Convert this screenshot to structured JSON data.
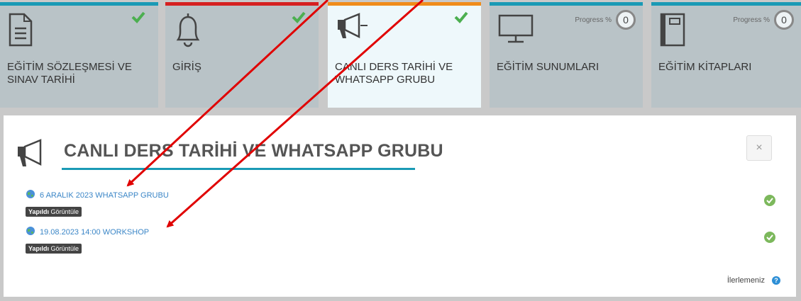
{
  "colors": {
    "tile_accent": "#1a9ab5",
    "tile_red_accent": "#d62020",
    "tile_orange_accent": "#f08c1a",
    "check_green": "#4caf50",
    "link_blue": "#3b86c7",
    "arrow_red": "#e00000"
  },
  "tiles": [
    {
      "title": "EĞİTİM SÖZLEŞMESİ VE SINAV TARİHİ",
      "icon": "document-icon",
      "status": "completed"
    },
    {
      "title": "GİRİŞ",
      "icon": "bell-icon",
      "status": "completed"
    },
    {
      "title": "CANLI DERS TARİHİ VE WHATSAPP GRUBU",
      "icon": "megaphone-icon",
      "status": "completed",
      "active": true
    },
    {
      "title": "EĞİTİM SUNUMLARI",
      "icon": "monitor-icon",
      "progress_label": "Progress %",
      "progress_value": "0"
    },
    {
      "title": "EĞİTİM KİTAPLARI",
      "icon": "book-icon",
      "progress_label": "Progress %",
      "progress_value": "0"
    }
  ],
  "panel": {
    "title": "CANLI DERS TARİHİ VE WHATSAPP GRUBU",
    "icon": "megaphone-icon",
    "close_label": "×",
    "activities": [
      {
        "label": "6 ARALIK 2023 WHATSAPP GRUBU",
        "badge_bold": "Yapıldı",
        "badge_text": "Görüntüle",
        "status": "done"
      },
      {
        "label": "19.08.2023 14:00 WORKSHOP",
        "badge_bold": "Yapıldı",
        "badge_text": "Görüntüle",
        "status": "done"
      }
    ],
    "footer_label": "İlerlemeniz",
    "help_label": "?"
  }
}
